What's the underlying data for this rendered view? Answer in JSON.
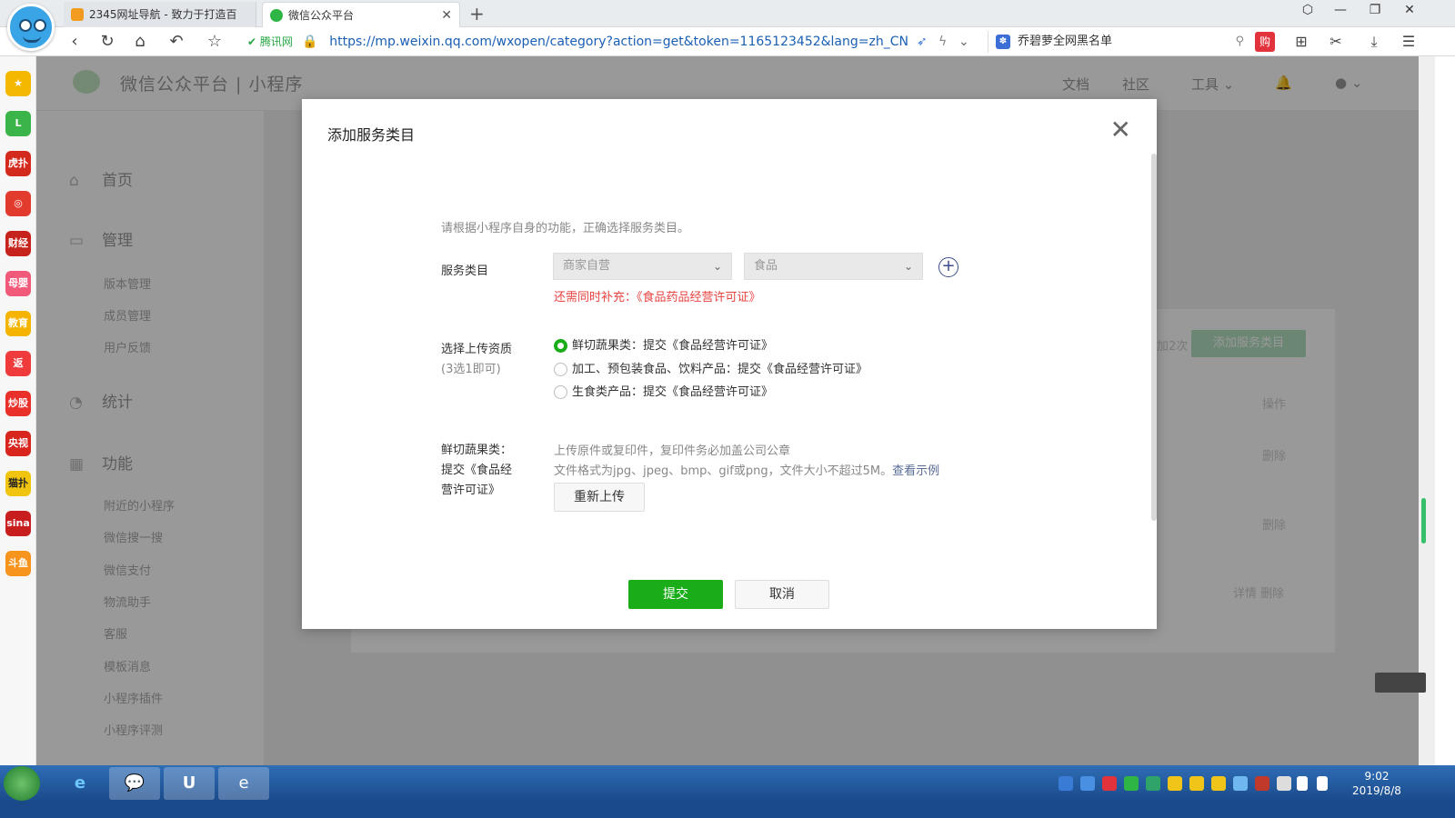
{
  "browser": {
    "tabs": [
      {
        "title": "2345网址导航 - 致力于打造百",
        "active": false
      },
      {
        "title": "微信公众平台",
        "active": true
      }
    ],
    "new_tab": "+",
    "url_secure_label": "腾讯网",
    "url": "https://mp.weixin.qq.com/wxopen/category?action=get&token=1165123452&lang=zh_CN",
    "search_text": "乔碧萝全网黑名单"
  },
  "sidebar_apps": [
    {
      "label": "★",
      "color": "#f5b800"
    },
    {
      "label": "L",
      "color": "#3bb54a"
    },
    {
      "label": "虎扑",
      "color": "#d42a1e"
    },
    {
      "label": "◎",
      "color": "#e23b2e"
    },
    {
      "label": "财经",
      "color": "#c5231b"
    },
    {
      "label": "母婴",
      "color": "#f25a7b"
    },
    {
      "label": "教育",
      "color": "#f4b400"
    },
    {
      "label": "返",
      "color": "#ef3b3b"
    },
    {
      "label": "炒股",
      "color": "#e9302a"
    },
    {
      "label": "央视",
      "color": "#d8261f"
    },
    {
      "label": "猫扑",
      "color": "#f1c40f"
    },
    {
      "label": "sina",
      "color": "#c81e1e"
    },
    {
      "label": "斗鱼",
      "color": "#f7941d"
    }
  ],
  "mp": {
    "title": "微信公众平台  |  小程序",
    "nav": {
      "docs": "文档",
      "community": "社区",
      "tools": "工具"
    },
    "menu": {
      "home": "首页",
      "manage": "管理",
      "manage_items": [
        "版本管理",
        "成员管理",
        "用户反馈"
      ],
      "stats": "统计",
      "features": "功能",
      "feature_items": [
        "附近的小程序",
        "微信搜一搜",
        "微信支付",
        "物流助手",
        "客服",
        "模板消息",
        "小程序插件",
        "小程序评测"
      ]
    },
    "add_category_button": "添加服务类目",
    "remaining_text": "加2次",
    "table_header_action": "操作",
    "row_actions": [
      "删除",
      "删除",
      "详情 删除"
    ]
  },
  "dialog": {
    "title": "添加服务类目",
    "intro": "请根据小程序自身的功能，正确选择服务类目。",
    "category_label": "服务类目",
    "category_primary": "商家自营",
    "category_secondary": "食品",
    "supplement_warning": "还需同时补充：《食品药品经营许可证》",
    "qualification_label": "选择上传资质",
    "qualification_hint": "(3选1即可)",
    "options": [
      {
        "label": "鲜切蔬果类：提交《食品经营许可证》",
        "selected": true
      },
      {
        "label": "加工、预包装食品、饮料产品：提交《食品经营许可证》",
        "selected": false
      },
      {
        "label": "生食类产品：提交《食品经营许可证》",
        "selected": false
      }
    ],
    "upload_label_lines": [
      "鲜切蔬果类：",
      "提交《食品经",
      "营许可证》"
    ],
    "upload_hint_1": "上传原件或复印件，复印件务必加盖公司公章",
    "upload_hint_2": "文件格式为jpg、jpeg、bmp、gif或png，文件大小不超过5M。",
    "view_example": "查看示例",
    "reupload_button": "重新上传",
    "submit_button": "提交",
    "cancel_button": "取消"
  },
  "taskbar": {
    "time": "9:02",
    "date": "2019/8/8"
  }
}
